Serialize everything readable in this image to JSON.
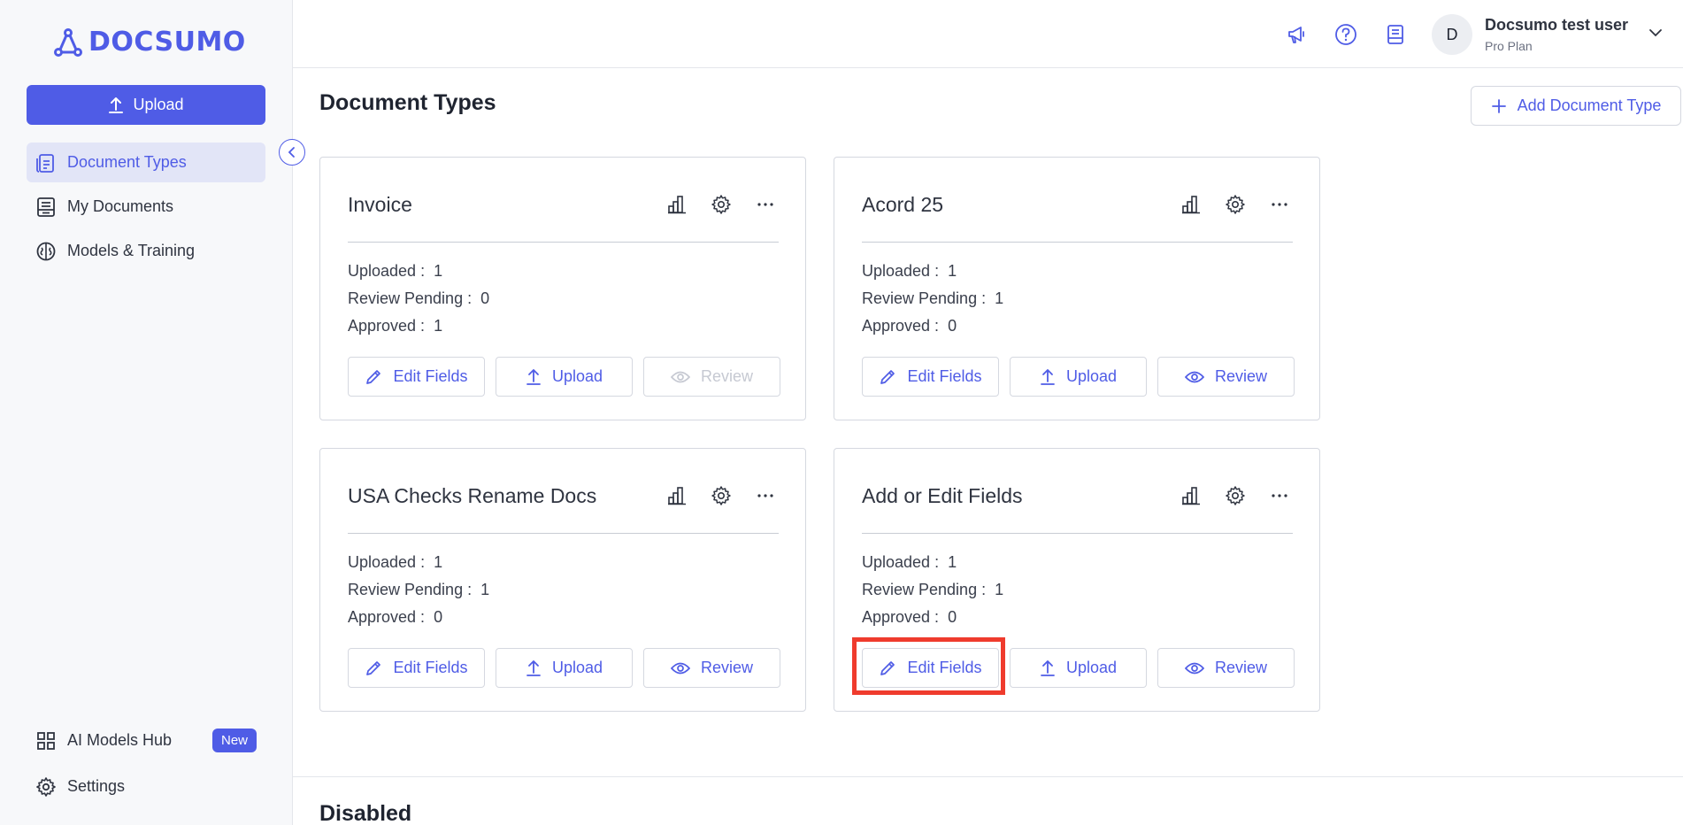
{
  "brand": {
    "name": "DOCSUMO",
    "color": "#4f5ce6"
  },
  "sidebar": {
    "upload_label": "Upload",
    "items": [
      {
        "label": "Document Types",
        "icon": "document-types-icon",
        "active": true
      },
      {
        "label": "My Documents",
        "icon": "documents-icon",
        "active": false
      },
      {
        "label": "Models & Training",
        "icon": "brain-icon",
        "active": false
      }
    ],
    "bottom_items": [
      {
        "label": "AI Models Hub",
        "icon": "grid-icon",
        "badge": "New"
      },
      {
        "label": "Settings",
        "icon": "gear-icon"
      }
    ]
  },
  "header": {
    "icons": [
      "megaphone-icon",
      "help-icon",
      "book-icon"
    ],
    "user": {
      "initial": "D",
      "name": "Docsumo test user",
      "plan": "Pro Plan"
    }
  },
  "main": {
    "title": "Document Types",
    "add_button_label": "Add Document Type",
    "stat_labels": {
      "uploaded": "Uploaded :",
      "review_pending": "Review Pending :",
      "approved": "Approved :"
    },
    "button_labels": {
      "edit": "Edit Fields",
      "upload": "Upload",
      "review": "Review"
    },
    "cards": [
      {
        "title": "Invoice",
        "uploaded": "1",
        "review_pending": "0",
        "approved": "1",
        "review_enabled": false
      },
      {
        "title": "Acord 25",
        "uploaded": "1",
        "review_pending": "1",
        "approved": "0",
        "review_enabled": true
      },
      {
        "title": "USA Checks Rename Docs",
        "uploaded": "1",
        "review_pending": "1",
        "approved": "0",
        "review_enabled": true
      },
      {
        "title": "Add or Edit Fields",
        "uploaded": "1",
        "review_pending": "1",
        "approved": "0",
        "review_enabled": true
      }
    ],
    "disabled_section_title": "Disabled"
  },
  "colors": {
    "accent": "#4f5ce6",
    "highlight": "#ef3b2d",
    "disabled": "#c6c9d2"
  }
}
